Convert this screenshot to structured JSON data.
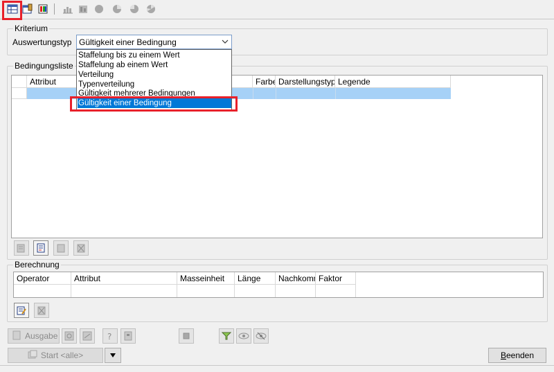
{
  "toolbar": {
    "icons": [
      "table-view-icon",
      "table-edit-icon",
      "color-table-icon",
      "bar-chart-icon",
      "stacked-chart-icon",
      "circle-chart-icon",
      "pie-chart-icon",
      "donut-chart-icon",
      "segmented-chart-icon"
    ]
  },
  "kriterium": {
    "group_label": "Kriterium",
    "type_label": "Auswertungstyp",
    "selected_value": "Gültigkeit einer Bedingung",
    "options": [
      "Staffelung bis zu einem Wert",
      "Staffelung ab einem Wert",
      "Verteilung",
      "Typenverteilung",
      "Gültigkeit mehrerer Bedingungen",
      "Gültigkeit einer Bedingung"
    ],
    "selected_index": 5
  },
  "bedingungsliste": {
    "group_label": "Bedingungsliste",
    "columns": [
      "Attribut",
      "Farbe",
      "Darstellungstyp",
      "Legende"
    ]
  },
  "berechnung": {
    "group_label": "Berechnung",
    "columns": [
      "Operator",
      "Attribut",
      "Masseinheit",
      "Länge",
      "Nachkomm",
      "Faktor"
    ]
  },
  "bottom": {
    "ausgabe_label": "Ausgabe",
    "start_label": "Start <alle>",
    "beenden_label": "Beenden",
    "beenden_rest": "eenden",
    "beenden_mnemonic": "B"
  },
  "colors": {
    "selection": "#0078d7",
    "highlight_row": "#a6d1f7",
    "annotation": "#e8202a"
  }
}
